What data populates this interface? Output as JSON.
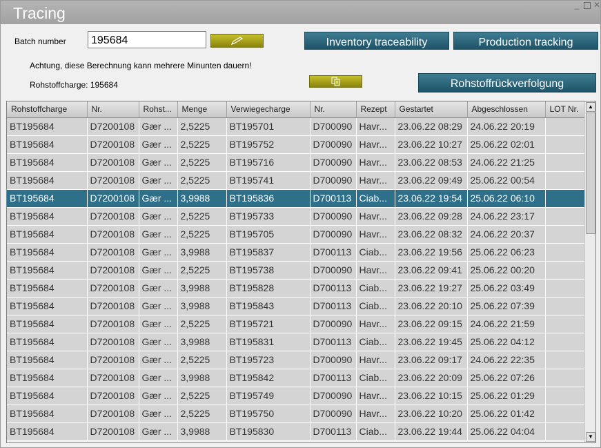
{
  "window": {
    "title": "Tracing"
  },
  "form": {
    "batch_label": "Batch number",
    "batch_value": "195684",
    "warning": "Achtung, diese Berechnung kann mehrere Minunten dauern!",
    "raw_batch_text": "Rohstoffcharge: 195684"
  },
  "buttons": {
    "inventory": "Inventory traceability",
    "production": "Production tracking",
    "raw_tracking": "Rohstoffrückverfolgung",
    "edit_icon": "pencil-icon",
    "copy_icon": "copy-icon"
  },
  "colors": {
    "button_blue": "#2a6479",
    "button_olive": "#a8a21c",
    "selected_row": "#2e6f8a",
    "row_bg": "#d4d4d4"
  },
  "table": {
    "columns": [
      "Rohstoffcharge",
      "Nr.",
      "Rohst...",
      "Menge",
      "Verwiegecharge",
      "Nr.",
      "Rezept",
      "Gestartet",
      "Abgeschlossen",
      "LOT Nr."
    ],
    "selected_index": 4,
    "rows": [
      [
        "BT195684",
        "D7200108",
        "Gær ...",
        "2,5225",
        "BT195701",
        "D700090",
        "Havr...",
        "23.06.22 08:29",
        "24.06.22 20:19",
        ""
      ],
      [
        "BT195684",
        "D7200108",
        "Gær ...",
        "2,5225",
        "BT195752",
        "D700090",
        "Havr...",
        "23.06.22 10:27",
        "25.06.22 02:01",
        ""
      ],
      [
        "BT195684",
        "D7200108",
        "Gær ...",
        "2,5225",
        "BT195716",
        "D700090",
        "Havr...",
        "23.06.22 08:53",
        "24.06.22 21:25",
        ""
      ],
      [
        "BT195684",
        "D7200108",
        "Gær ...",
        "2,5225",
        "BT195741",
        "D700090",
        "Havr...",
        "23.06.22 09:49",
        "25.06.22 00:54",
        ""
      ],
      [
        "BT195684",
        "D7200108",
        "Gær ...",
        "3,9988",
        "BT195836",
        "D700113",
        "Ciab...",
        "23.06.22 19:54",
        "25.06.22 06:10",
        ""
      ],
      [
        "BT195684",
        "D7200108",
        "Gær ...",
        "2,5225",
        "BT195733",
        "D700090",
        "Havr...",
        "23.06.22 09:28",
        "24.06.22 23:17",
        ""
      ],
      [
        "BT195684",
        "D7200108",
        "Gær ...",
        "2,5225",
        "BT195705",
        "D700090",
        "Havr...",
        "23.06.22 08:32",
        "24.06.22 20:37",
        ""
      ],
      [
        "BT195684",
        "D7200108",
        "Gær ...",
        "3,9988",
        "BT195837",
        "D700113",
        "Ciab...",
        "23.06.22 19:56",
        "25.06.22 06:23",
        ""
      ],
      [
        "BT195684",
        "D7200108",
        "Gær ...",
        "2,5225",
        "BT195738",
        "D700090",
        "Havr...",
        "23.06.22 09:41",
        "25.06.22 00:20",
        ""
      ],
      [
        "BT195684",
        "D7200108",
        "Gær ...",
        "3,9988",
        "BT195828",
        "D700113",
        "Ciab...",
        "23.06.22 19:27",
        "25.06.22 03:49",
        ""
      ],
      [
        "BT195684",
        "D7200108",
        "Gær ...",
        "3,9988",
        "BT195843",
        "D700113",
        "Ciab...",
        "23.06.22 20:10",
        "25.06.22 07:39",
        ""
      ],
      [
        "BT195684",
        "D7200108",
        "Gær ...",
        "2,5225",
        "BT195721",
        "D700090",
        "Havr...",
        "23.06.22 09:15",
        "24.06.22 21:59",
        ""
      ],
      [
        "BT195684",
        "D7200108",
        "Gær ...",
        "3,9988",
        "BT195831",
        "D700113",
        "Ciab...",
        "23.06.22 19:45",
        "25.06.22 04:12",
        ""
      ],
      [
        "BT195684",
        "D7200108",
        "Gær ...",
        "2,5225",
        "BT195723",
        "D700090",
        "Havr...",
        "23.06.22 09:17",
        "24.06.22 22:35",
        ""
      ],
      [
        "BT195684",
        "D7200108",
        "Gær ...",
        "3,9988",
        "BT195842",
        "D700113",
        "Ciab...",
        "23.06.22 20:09",
        "25.06.22 07:26",
        ""
      ],
      [
        "BT195684",
        "D7200108",
        "Gær ...",
        "2,5225",
        "BT195749",
        "D700090",
        "Havr...",
        "23.06.22 10:15",
        "25.06.22 01:29",
        ""
      ],
      [
        "BT195684",
        "D7200108",
        "Gær ...",
        "2,5225",
        "BT195750",
        "D700090",
        "Havr...",
        "23.06.22 10:20",
        "25.06.22 01:42",
        ""
      ],
      [
        "BT195684",
        "D7200108",
        "Gær ...",
        "3,9988",
        "BT195830",
        "D700113",
        "Ciab...",
        "23.06.22 19:44",
        "25.06.22 04:04",
        ""
      ]
    ]
  }
}
